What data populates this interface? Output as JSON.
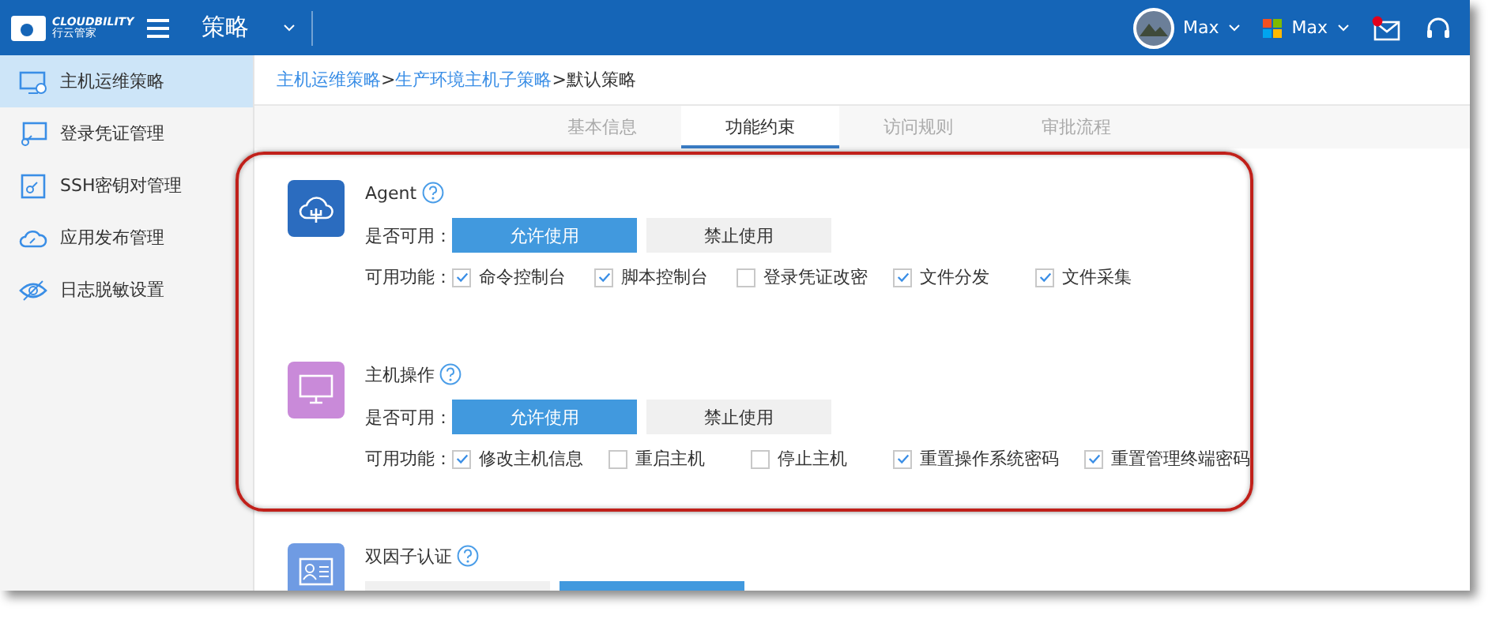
{
  "header": {
    "logo_text": "CLOUDBILITY",
    "logo_subtext": "行云管家",
    "title": "策略",
    "user": "Max",
    "account": "Max",
    "mail_unread": true
  },
  "sidebar": {
    "items": [
      {
        "label": "主机运维策略",
        "selected": true
      },
      {
        "label": "登录凭证管理",
        "selected": false
      },
      {
        "label": "SSH密钥对管理",
        "selected": false
      },
      {
        "label": "应用发布管理",
        "selected": false
      },
      {
        "label": "日志脱敏设置",
        "selected": false
      }
    ]
  },
  "breadcrumb": [
    {
      "text": "主机运维策略",
      "kind": "link"
    },
    {
      "text": ">",
      "kind": "sep"
    },
    {
      "text": "生产环境主机子策略",
      "kind": "link"
    },
    {
      "text": ">",
      "kind": "sep"
    },
    {
      "text": "默认策略",
      "kind": "current"
    }
  ],
  "tabs": [
    {
      "label": "基本信息",
      "selected": false
    },
    {
      "label": "功能约束",
      "selected": true
    },
    {
      "label": "访问规则",
      "selected": false
    },
    {
      "label": "审批流程",
      "selected": false
    }
  ],
  "sections": [
    {
      "title": "Agent",
      "color": "#2b6cbf",
      "enable_label": "是否可用：",
      "options": [
        {
          "label": "允许使用",
          "selected": true
        },
        {
          "label": "禁止使用",
          "selected": false
        }
      ],
      "features_label": "可用功能：",
      "features": [
        {
          "label": "命令控制台",
          "checked": true
        },
        {
          "label": "脚本控制台",
          "checked": true
        },
        {
          "label": "登录凭证改密",
          "checked": false
        },
        {
          "label": "文件分发",
          "checked": true
        },
        {
          "label": "文件采集",
          "checked": true
        }
      ]
    },
    {
      "title": "主机操作",
      "color": "#c98ad9",
      "enable_label": "是否可用：",
      "options": [
        {
          "label": "允许使用",
          "selected": true
        },
        {
          "label": "禁止使用",
          "selected": false
        }
      ],
      "features_label": "可用功能：",
      "features": [
        {
          "label": "修改主机信息",
          "checked": true
        },
        {
          "label": "重启主机",
          "checked": false
        },
        {
          "label": "停止主机",
          "checked": false
        },
        {
          "label": "重置操作系统密码",
          "checked": true
        },
        {
          "label": "重置管理终端密码",
          "checked": true
        }
      ]
    },
    {
      "title": "双因子认证",
      "color": "#6f9be3",
      "options": [
        {
          "selected": false
        },
        {
          "selected": true
        }
      ]
    }
  ]
}
